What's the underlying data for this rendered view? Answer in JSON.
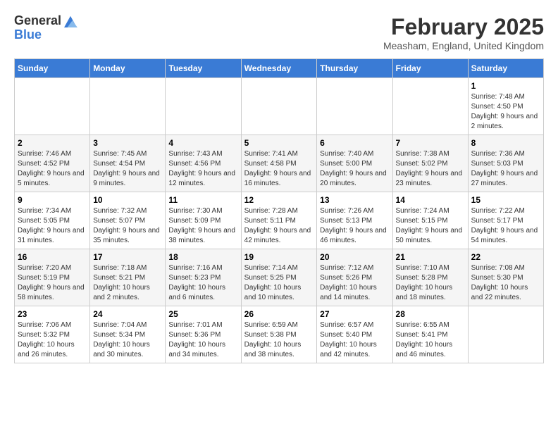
{
  "header": {
    "logo_line1": "General",
    "logo_line2": "Blue",
    "main_title": "February 2025",
    "subtitle": "Measham, England, United Kingdom"
  },
  "columns": [
    "Sunday",
    "Monday",
    "Tuesday",
    "Wednesday",
    "Thursday",
    "Friday",
    "Saturday"
  ],
  "weeks": [
    [
      {
        "num": "",
        "info": ""
      },
      {
        "num": "",
        "info": ""
      },
      {
        "num": "",
        "info": ""
      },
      {
        "num": "",
        "info": ""
      },
      {
        "num": "",
        "info": ""
      },
      {
        "num": "",
        "info": ""
      },
      {
        "num": "1",
        "info": "Sunrise: 7:48 AM\nSunset: 4:50 PM\nDaylight: 9 hours and 2 minutes."
      }
    ],
    [
      {
        "num": "2",
        "info": "Sunrise: 7:46 AM\nSunset: 4:52 PM\nDaylight: 9 hours and 5 minutes."
      },
      {
        "num": "3",
        "info": "Sunrise: 7:45 AM\nSunset: 4:54 PM\nDaylight: 9 hours and 9 minutes."
      },
      {
        "num": "4",
        "info": "Sunrise: 7:43 AM\nSunset: 4:56 PM\nDaylight: 9 hours and 12 minutes."
      },
      {
        "num": "5",
        "info": "Sunrise: 7:41 AM\nSunset: 4:58 PM\nDaylight: 9 hours and 16 minutes."
      },
      {
        "num": "6",
        "info": "Sunrise: 7:40 AM\nSunset: 5:00 PM\nDaylight: 9 hours and 20 minutes."
      },
      {
        "num": "7",
        "info": "Sunrise: 7:38 AM\nSunset: 5:02 PM\nDaylight: 9 hours and 23 minutes."
      },
      {
        "num": "8",
        "info": "Sunrise: 7:36 AM\nSunset: 5:03 PM\nDaylight: 9 hours and 27 minutes."
      }
    ],
    [
      {
        "num": "9",
        "info": "Sunrise: 7:34 AM\nSunset: 5:05 PM\nDaylight: 9 hours and 31 minutes."
      },
      {
        "num": "10",
        "info": "Sunrise: 7:32 AM\nSunset: 5:07 PM\nDaylight: 9 hours and 35 minutes."
      },
      {
        "num": "11",
        "info": "Sunrise: 7:30 AM\nSunset: 5:09 PM\nDaylight: 9 hours and 38 minutes."
      },
      {
        "num": "12",
        "info": "Sunrise: 7:28 AM\nSunset: 5:11 PM\nDaylight: 9 hours and 42 minutes."
      },
      {
        "num": "13",
        "info": "Sunrise: 7:26 AM\nSunset: 5:13 PM\nDaylight: 9 hours and 46 minutes."
      },
      {
        "num": "14",
        "info": "Sunrise: 7:24 AM\nSunset: 5:15 PM\nDaylight: 9 hours and 50 minutes."
      },
      {
        "num": "15",
        "info": "Sunrise: 7:22 AM\nSunset: 5:17 PM\nDaylight: 9 hours and 54 minutes."
      }
    ],
    [
      {
        "num": "16",
        "info": "Sunrise: 7:20 AM\nSunset: 5:19 PM\nDaylight: 9 hours and 58 minutes."
      },
      {
        "num": "17",
        "info": "Sunrise: 7:18 AM\nSunset: 5:21 PM\nDaylight: 10 hours and 2 minutes."
      },
      {
        "num": "18",
        "info": "Sunrise: 7:16 AM\nSunset: 5:23 PM\nDaylight: 10 hours and 6 minutes."
      },
      {
        "num": "19",
        "info": "Sunrise: 7:14 AM\nSunset: 5:25 PM\nDaylight: 10 hours and 10 minutes."
      },
      {
        "num": "20",
        "info": "Sunrise: 7:12 AM\nSunset: 5:26 PM\nDaylight: 10 hours and 14 minutes."
      },
      {
        "num": "21",
        "info": "Sunrise: 7:10 AM\nSunset: 5:28 PM\nDaylight: 10 hours and 18 minutes."
      },
      {
        "num": "22",
        "info": "Sunrise: 7:08 AM\nSunset: 5:30 PM\nDaylight: 10 hours and 22 minutes."
      }
    ],
    [
      {
        "num": "23",
        "info": "Sunrise: 7:06 AM\nSunset: 5:32 PM\nDaylight: 10 hours and 26 minutes."
      },
      {
        "num": "24",
        "info": "Sunrise: 7:04 AM\nSunset: 5:34 PM\nDaylight: 10 hours and 30 minutes."
      },
      {
        "num": "25",
        "info": "Sunrise: 7:01 AM\nSunset: 5:36 PM\nDaylight: 10 hours and 34 minutes."
      },
      {
        "num": "26",
        "info": "Sunrise: 6:59 AM\nSunset: 5:38 PM\nDaylight: 10 hours and 38 minutes."
      },
      {
        "num": "27",
        "info": "Sunrise: 6:57 AM\nSunset: 5:40 PM\nDaylight: 10 hours and 42 minutes."
      },
      {
        "num": "28",
        "info": "Sunrise: 6:55 AM\nSunset: 5:41 PM\nDaylight: 10 hours and 46 minutes."
      },
      {
        "num": "",
        "info": ""
      }
    ]
  ]
}
